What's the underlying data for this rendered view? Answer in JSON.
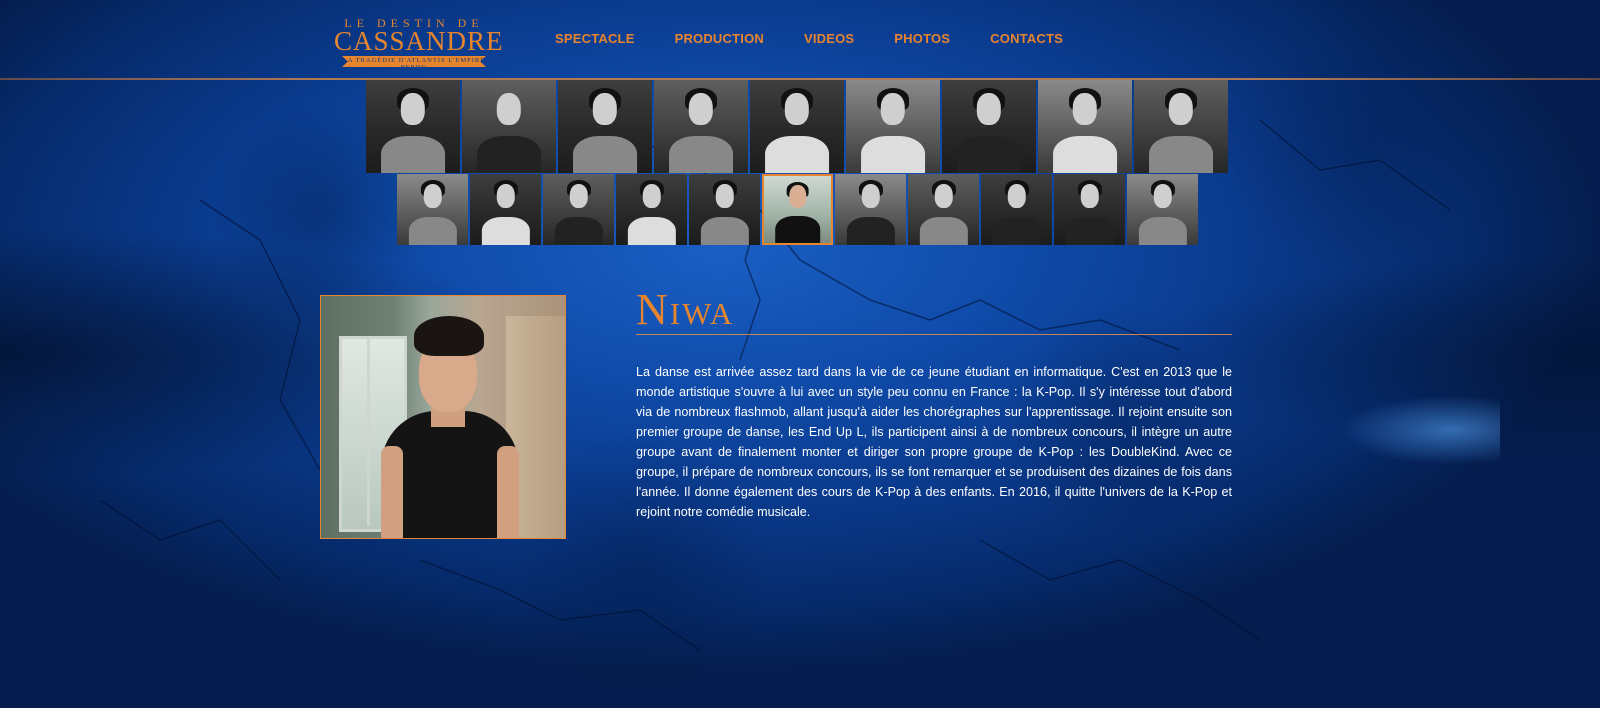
{
  "logo": {
    "top": "LE DESTIN DE",
    "main": "CASSANDRE",
    "subtitle": "LA TRAGÉDIE D'ATLANTIS L'EMPIRE PERDU"
  },
  "nav": [
    "SPECTACLE",
    "PRODUCTION",
    "VIDEOS",
    "PHOTOS",
    "CONTACTS"
  ],
  "profile": {
    "name": "Niwa",
    "bio": "La danse est arrivée assez tard dans la vie de ce jeune étudiant en informatique. C'est en 2013 que le monde artistique s'ouvre à lui avec un style peu connu en France : la K-Pop. Il s'y intéresse tout d'abord via de nombreux flashmob, allant jusqu'à aider les chorégraphes sur l'apprentissage. Il rejoint ensuite son premier groupe de danse, les End Up L, ils participent ainsi à de nombreux concours, il intègre un autre groupe avant de finalement monter et diriger son propre groupe de K-Pop : les DoubleKind. Avec ce groupe, il prépare de nombreux concours, ils se font remarquer et se produisent des dizaines de fois dans l'année. Il donne également des cours de K-Pop à des enfants. En 2016, il quitte l'univers de la K-Pop et rejoint notre comédie musicale."
  },
  "colors": {
    "accent": "#e7852f",
    "background": "#0f4aa8"
  }
}
